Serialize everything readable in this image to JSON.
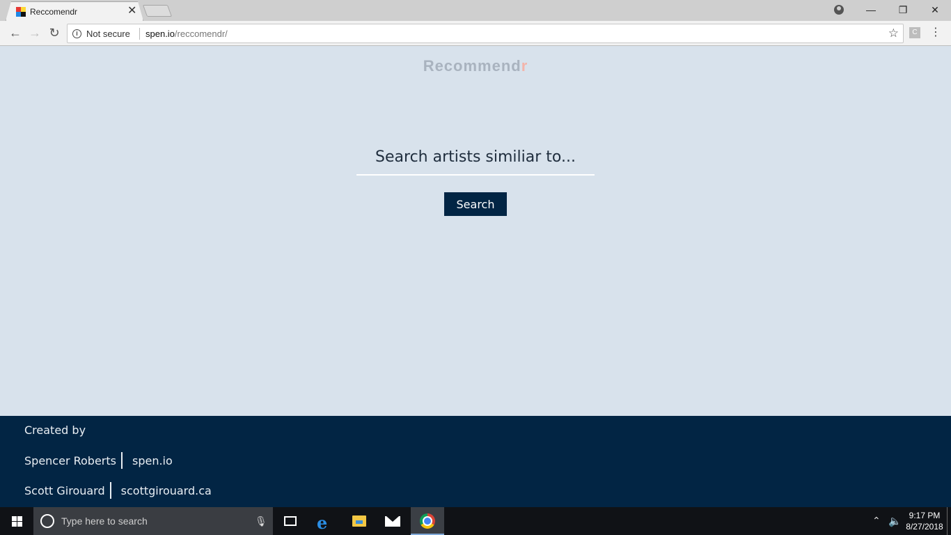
{
  "browser": {
    "tab_title": "Reccomendr",
    "tab_close": "✕",
    "address": {
      "security_label": "Not secure",
      "host": "spen.io",
      "path": "/reccomendr/"
    },
    "window_controls": {
      "minimize": "—",
      "restore": "❐",
      "close": "✕"
    },
    "extension_label": "C",
    "menu_glyph": "⋮"
  },
  "page": {
    "logo_main": "Recommend",
    "logo_accent": "r",
    "search": {
      "placeholder": "Search artists similiar to...",
      "value": "",
      "button_label": "Search"
    }
  },
  "footer": {
    "created_by": "Created by",
    "credits": [
      {
        "name": "Spencer Roberts",
        "site": "spen.io"
      },
      {
        "name": "Scott Girouard",
        "site": "scottgirouard.ca"
      }
    ]
  },
  "taskbar": {
    "search_placeholder": "Type here to search",
    "clock_time": "9:17 PM",
    "clock_date": "8/27/2018",
    "apps": [
      "task-view",
      "edge",
      "file-explorer",
      "mail",
      "chrome"
    ]
  },
  "colors": {
    "page_bg": "#d8e2ec",
    "navy": "#022544",
    "logo_text": "#a9b3bf",
    "logo_accent": "#f3b4aa"
  }
}
